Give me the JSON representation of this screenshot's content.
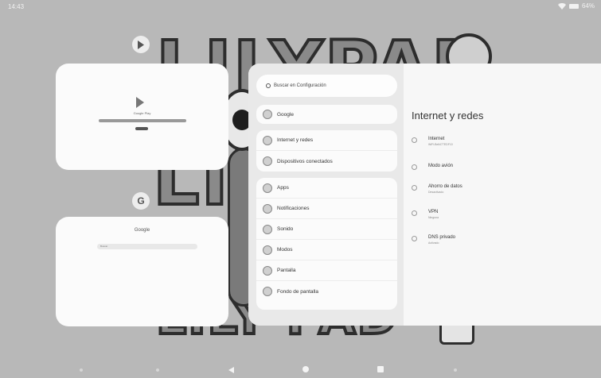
{
  "status_bar": {
    "time": "14:43",
    "battery": "64%"
  },
  "wallpaper": {
    "letters_top": "LILYPAD",
    "letters_mid": "LIL",
    "letters_bottom": "LILY PAD"
  },
  "recents": {
    "cards": [
      {
        "app_icon": "play-store-icon",
        "title": "Google Play"
      },
      {
        "app_icon": "google-g-icon",
        "icon_letter": "G",
        "title": "Google",
        "search_hint": "Buscar"
      }
    ]
  },
  "settings": {
    "search_placeholder": "Buscar en Configuración",
    "left_menu": [
      {
        "label": "Google"
      },
      {
        "label": "Internet y redes"
      },
      {
        "label": "Dispositivos conectados"
      },
      {
        "label": "Apps"
      },
      {
        "label": "Notificaciones"
      },
      {
        "label": "Sonido"
      },
      {
        "label": "Modos"
      },
      {
        "label": "Pantalla"
      },
      {
        "label": "Fondo de pantalla"
      }
    ],
    "panel": {
      "title": "Internet y redes",
      "items": [
        {
          "title": "Internet",
          "subtitle": "WiFi-Bell477EDF10",
          "icon": "wifi-icon"
        },
        {
          "title": "Modo avión",
          "subtitle": "",
          "icon": "airplane-icon"
        },
        {
          "title": "Ahorro de datos",
          "subtitle": "Desactivado",
          "icon": "data-saver-icon"
        },
        {
          "title": "VPN",
          "subtitle": "Ninguna",
          "icon": "vpn-icon"
        },
        {
          "title": "DNS privado",
          "subtitle": "Activado",
          "icon": "dns-icon"
        }
      ]
    }
  },
  "colors": {
    "background": "#b8b8b8",
    "card": "#fbfbfb",
    "settings_left": "#e9e9e9",
    "settings_right": "#f7f7f7"
  }
}
